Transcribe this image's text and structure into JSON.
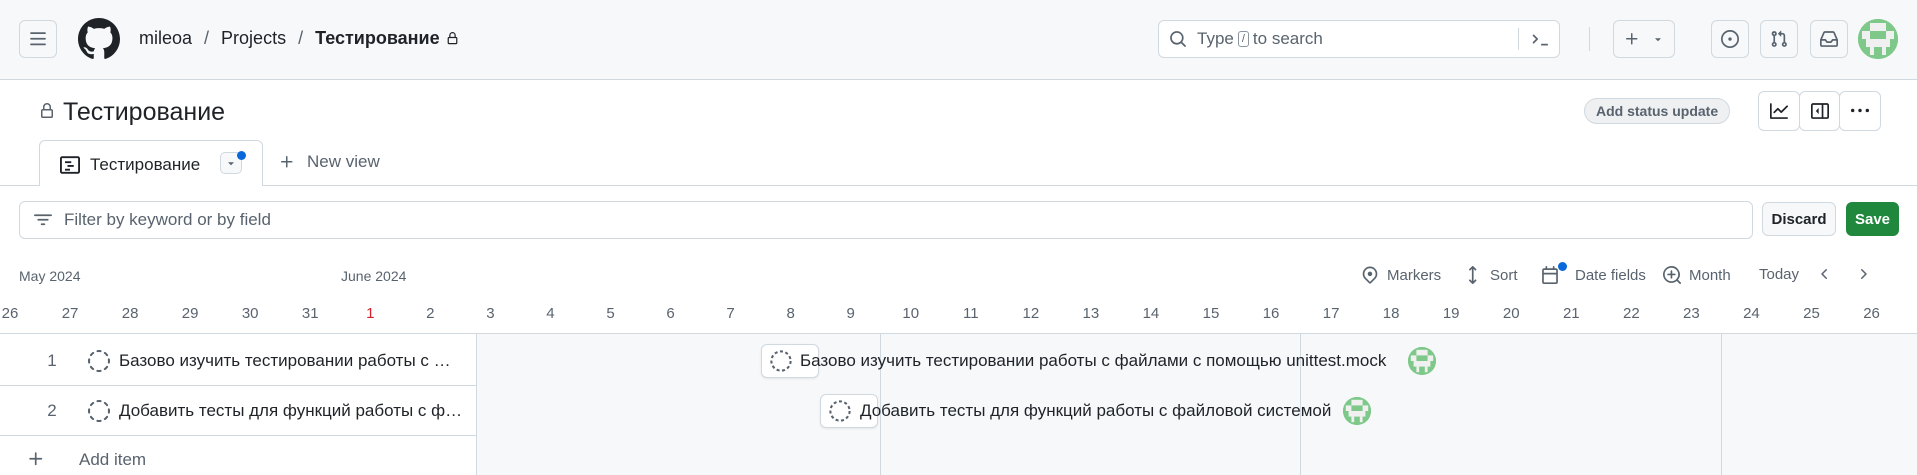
{
  "header": {
    "breadcrumb": {
      "owner": "mileoa",
      "sep1": "/",
      "projects": "Projects",
      "sep2": "/",
      "current": "Тестирование"
    },
    "search": {
      "prefix": "Type",
      "kbd": "/",
      "suffix": "to search"
    }
  },
  "project": {
    "title": "Тестирование",
    "status_update_label": "Add status update"
  },
  "tabs": {
    "active_label": "Тестирование",
    "new_view_label": "New view"
  },
  "filter": {
    "placeholder": "Filter by keyword or by field",
    "discard_label": "Discard",
    "save_label": "Save"
  },
  "timeline": {
    "months": [
      "May 2024",
      "June 2024"
    ],
    "controls": {
      "markers": "Markers",
      "sort": "Sort",
      "date_fields": "Date fields",
      "zoom": "Month",
      "today": "Today"
    },
    "days": [
      "26",
      "27",
      "28",
      "29",
      "30",
      "31",
      "1",
      "2",
      "3",
      "4",
      "5",
      "6",
      "7",
      "8",
      "9",
      "10",
      "11",
      "12",
      "13",
      "14",
      "15",
      "16",
      "17",
      "18",
      "19",
      "20",
      "21",
      "22",
      "23",
      "24",
      "25",
      "26"
    ],
    "highlight_day": "1"
  },
  "items": [
    {
      "number": "1",
      "title": "Базово изучить тестировании работы с файлами с помощью unittest.mock",
      "status": "draft"
    },
    {
      "number": "2",
      "title": "Добавить тесты для функций работы с файловой системой",
      "status": "draft"
    }
  ],
  "add_item_label": "Add item",
  "colors": {
    "accent": "#0969da",
    "save": "#1f883d",
    "today": "#cf222e",
    "avatar": "#7ec889"
  }
}
